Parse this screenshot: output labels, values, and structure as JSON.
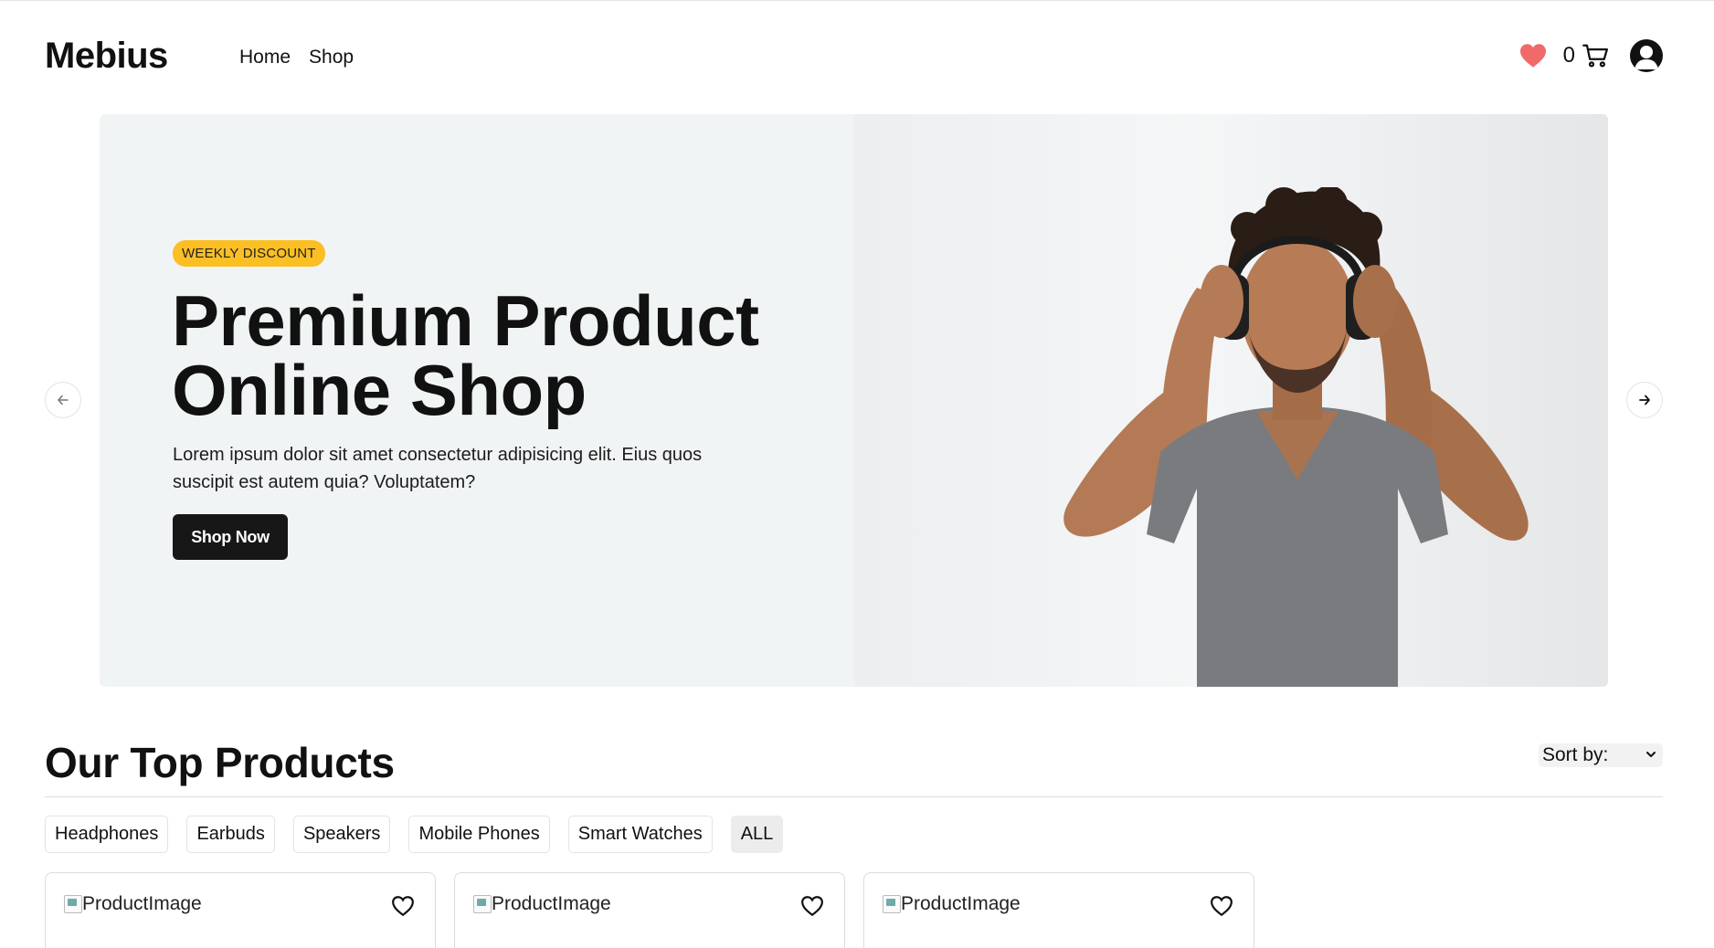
{
  "brand": {
    "name": "Mebius"
  },
  "nav": {
    "items": [
      {
        "label": "Home"
      },
      {
        "label": "Shop"
      }
    ]
  },
  "header": {
    "cart_count": "0",
    "wishlist_color": "#f06a6a"
  },
  "hero": {
    "badge": "WEEKLY DISCOUNT",
    "title_line1": "Premium Product",
    "title_line2": "Online Shop",
    "description": "Lorem ipsum dolor sit amet consectetur adipisicing elit. Eius quos suscipit est autem quia? Voluptatem?",
    "cta_label": "Shop Now",
    "badge_color": "#fbbf24"
  },
  "products_section": {
    "title": "Our Top Products",
    "sort_label": "Sort by:",
    "filters": [
      {
        "label": "Headphones"
      },
      {
        "label": "Earbuds"
      },
      {
        "label": "Speakers"
      },
      {
        "label": "Mobile Phones"
      },
      {
        "label": "Smart Watches"
      },
      {
        "label": "ALL",
        "active": true
      }
    ],
    "cards": [
      {
        "image_alt": "ProductImage"
      },
      {
        "image_alt": "ProductImage"
      },
      {
        "image_alt": "ProductImage"
      }
    ]
  }
}
